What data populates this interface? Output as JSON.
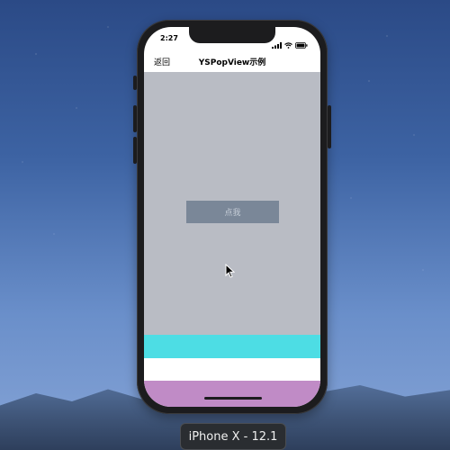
{
  "status_bar": {
    "time": "2:27"
  },
  "nav": {
    "back_label": "返回",
    "title": "YSPopView示例"
  },
  "main": {
    "button_label": "点我"
  },
  "colors": {
    "content_bg": "#b9bcc4",
    "button_bg": "#7a8798",
    "band_cyan": "#4ddde4",
    "band_white": "#ffffff",
    "band_purple": "#c08bc6"
  },
  "icons": [
    "signal-icon",
    "wifi-icon",
    "battery-icon",
    "cursor-icon"
  ],
  "simulator": {
    "device_label": "iPhone X - 12.1"
  }
}
